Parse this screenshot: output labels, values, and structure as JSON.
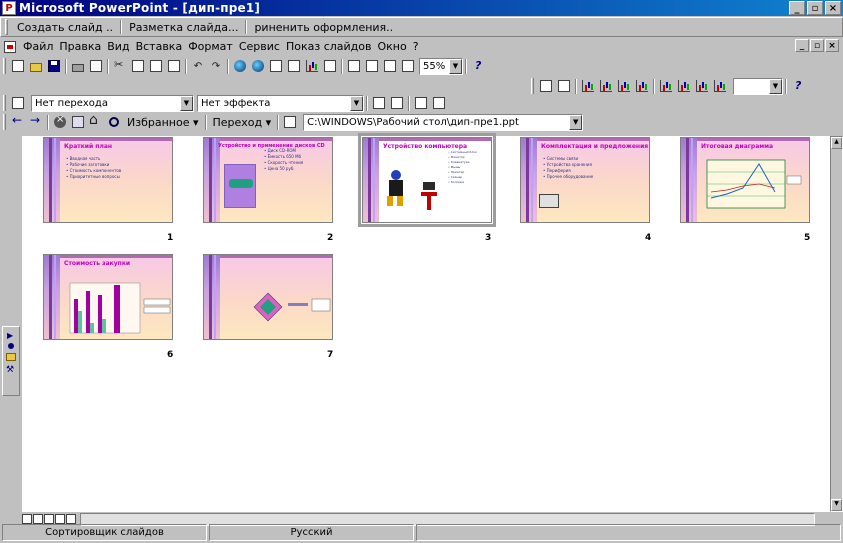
{
  "window": {
    "app_icon_letter": "P",
    "title": "Microsoft PowerPoint - [дип-пре1]"
  },
  "quick_commands": [
    "Создать слайд ..",
    "Разметка слайда...",
    "риненить оформления.."
  ],
  "menu": [
    "Файл",
    "Правка",
    "Вид",
    "Вставка",
    "Формат",
    "Сервис",
    "Показ слайдов",
    "Окно",
    "?"
  ],
  "standard_toolbar": {
    "zoom": "55%"
  },
  "transition_toolbar": {
    "transition_effect": "Нет перехода",
    "text_effect": "Нет эффекта"
  },
  "web_toolbar": {
    "favorites_label": "Избранное",
    "goto_label": "Переход",
    "address": "C:\\WINDOWS\\Рабочий стол\\дип-пре1.ppt"
  },
  "slides": [
    {
      "number": "1",
      "title": "Краткий план",
      "bullets": [
        "Вводная часть",
        "Рабочие заготовки",
        "Стоимость компонентов",
        "Приоритетные вопросы"
      ]
    },
    {
      "number": "2",
      "title": "Устройство и применение дисков CD",
      "bullets": [
        "Диск CD-ROM",
        "Ёмкость 650 Мб",
        "Скорость чтения",
        "Цена 50 руб."
      ]
    },
    {
      "number": "3",
      "title": "Устройство компьютера",
      "bullets": [
        "Системный блок",
        "Монитор",
        "Клавиатура",
        "Мышь",
        "Принтер",
        "Сканер",
        "Колонки"
      ]
    },
    {
      "number": "4",
      "title": "Комплектация и предложения",
      "bullets": [
        "Системы связи",
        "Устройства хранения",
        "Периферия",
        "Прочее оборудование"
      ]
    },
    {
      "number": "5",
      "title": "Итоговая диаграмма",
      "bullets": []
    },
    {
      "number": "6",
      "title": "Стоимость закупки",
      "bullets": []
    },
    {
      "number": "7",
      "title": "",
      "bullets": []
    }
  ],
  "status": {
    "view": "Сортировщик слайдов",
    "language": "Русский"
  }
}
